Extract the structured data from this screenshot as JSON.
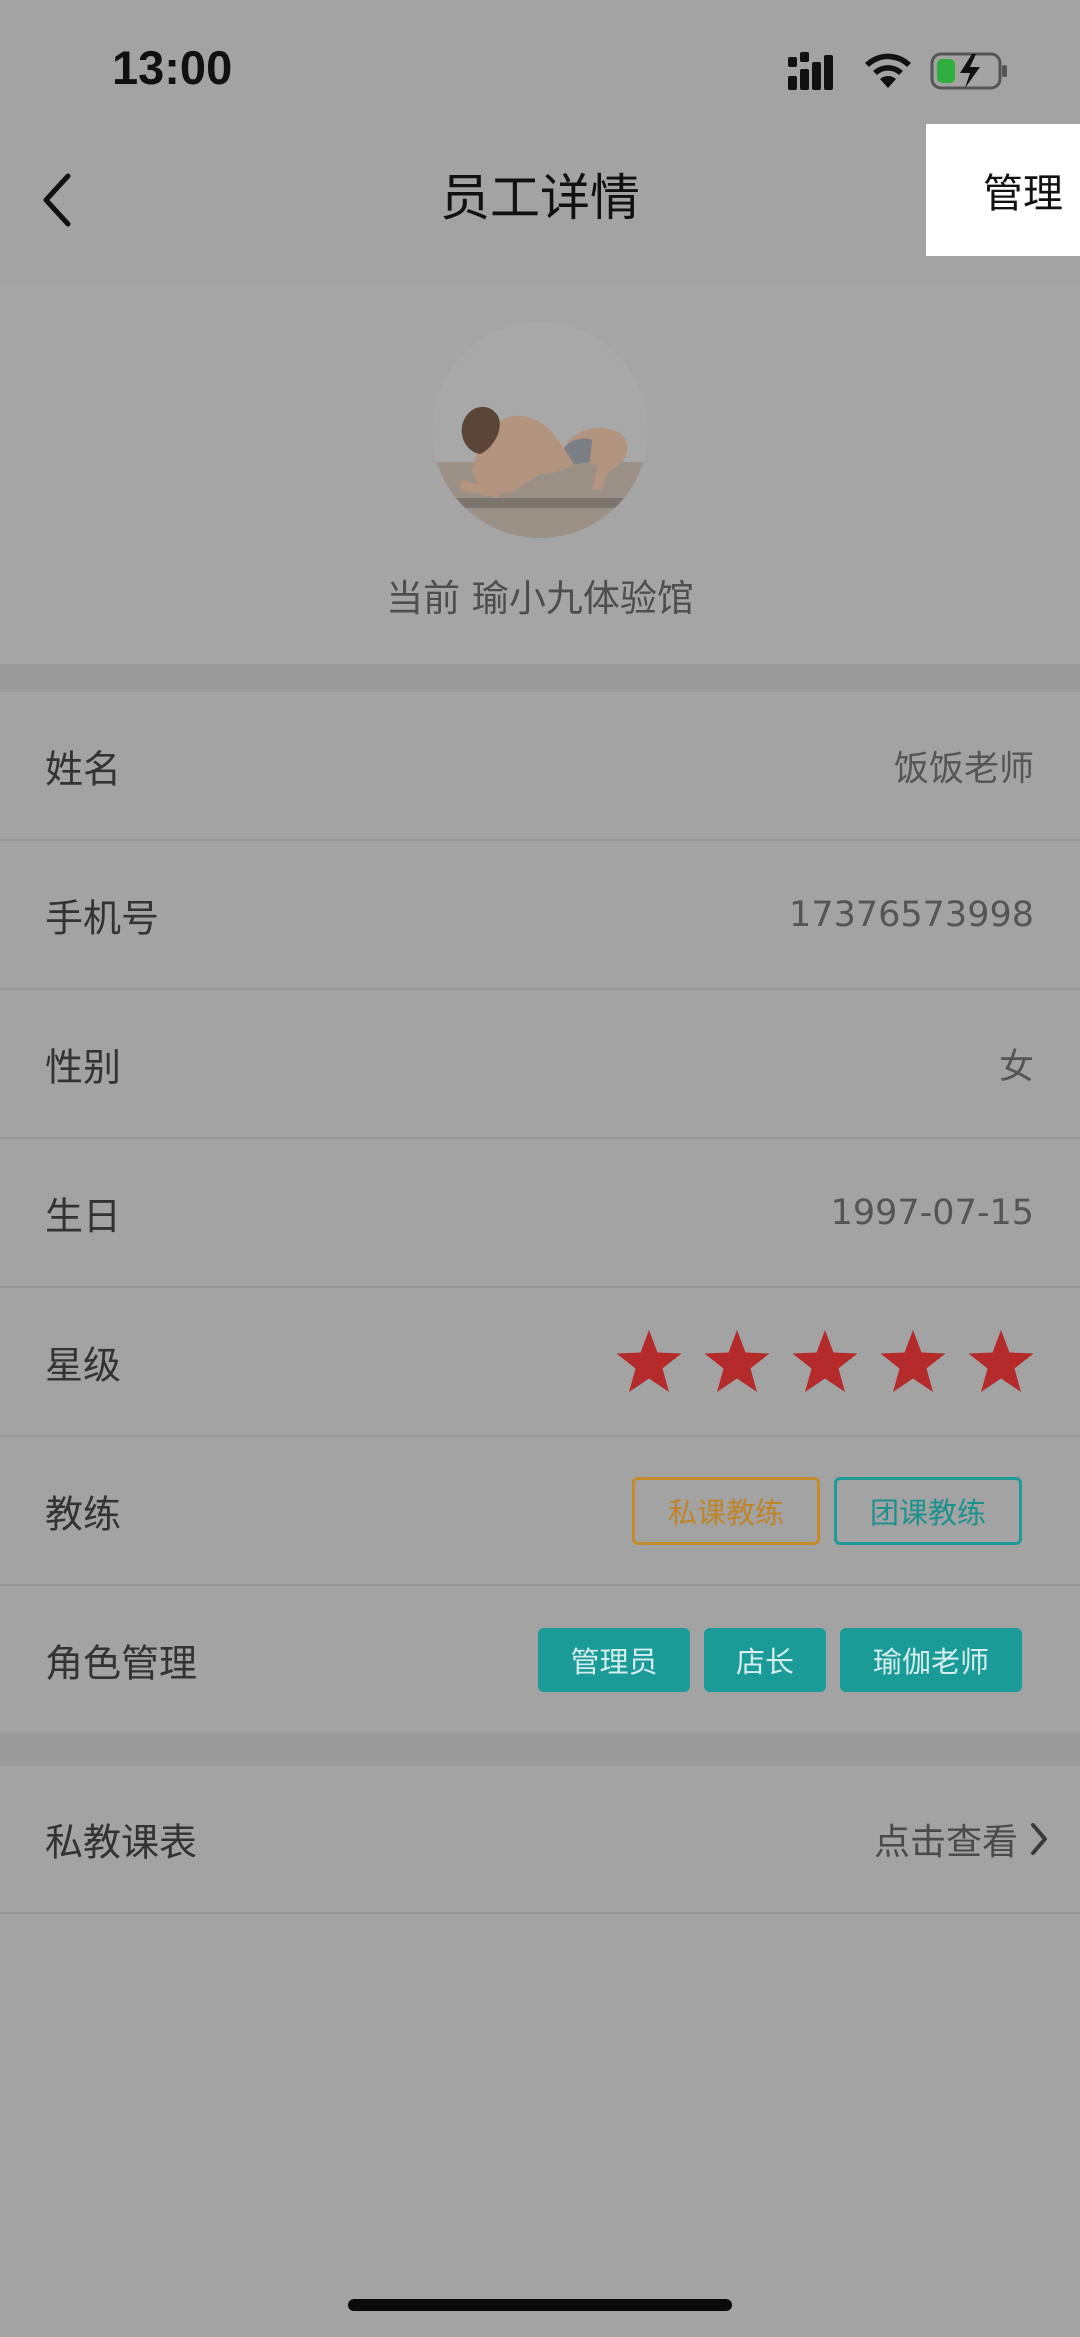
{
  "status_bar": {
    "time": "13:00",
    "signal_icon": "cellular-signal-icon",
    "wifi_icon": "wifi-icon",
    "battery_icon": "battery-charging-icon"
  },
  "nav": {
    "back_icon": "chevron-left-icon",
    "title": "员工详情",
    "manage_label": "管理"
  },
  "profile": {
    "avatar": "yoga-pose-photo",
    "current_store": "当前 瑜小九体验馆"
  },
  "fields": {
    "name": {
      "label": "姓名",
      "value": "饭饭老师"
    },
    "phone": {
      "label": "手机号",
      "value": "17376573998"
    },
    "gender": {
      "label": "性别",
      "value": "女"
    },
    "birthday": {
      "label": "生日",
      "value": "1997-07-15"
    },
    "rating": {
      "label": "星级",
      "stars": 5,
      "max_stars": 5,
      "star_color": "#b52a2a"
    },
    "coach": {
      "label": "教练",
      "tags": [
        "私课教练",
        "团课教练"
      ]
    },
    "roles": {
      "label": "角色管理",
      "tags": [
        "管理员",
        "店长",
        "瑜伽老师"
      ]
    }
  },
  "schedule": {
    "label": "私教课表",
    "link": "点击查看",
    "link_icon": "chevron-right-icon"
  },
  "colors": {
    "accent_teal": "#1a9b97",
    "accent_orange": "#c08428",
    "overlay_gray": "#a3a3a3"
  }
}
